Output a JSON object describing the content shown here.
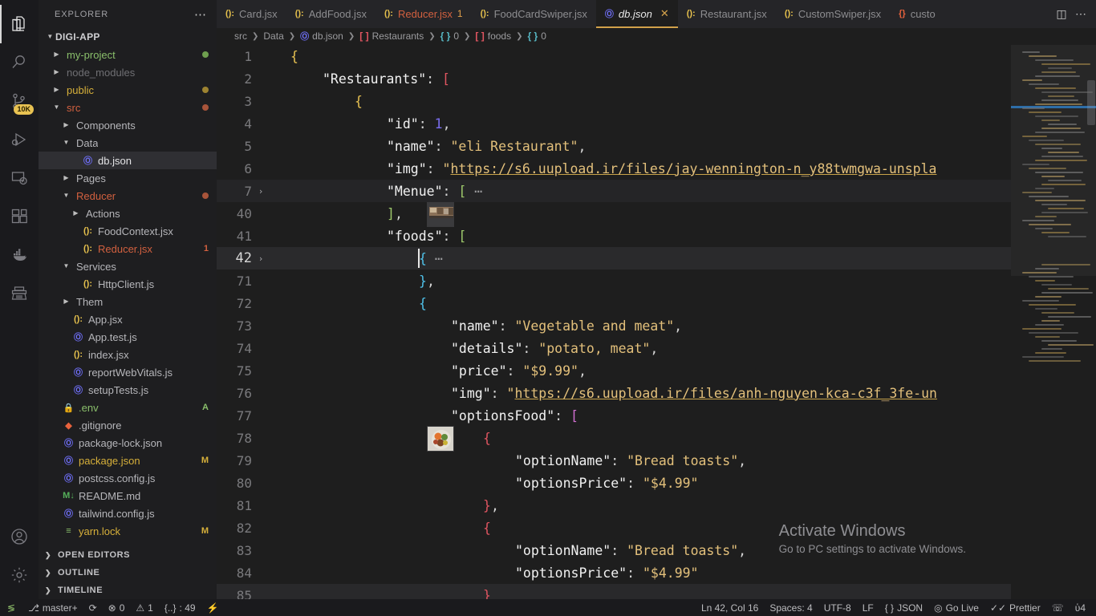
{
  "activity_bar": {
    "items": [
      {
        "name": "explorer",
        "icon": "files-icon",
        "active": true
      },
      {
        "name": "search",
        "icon": "search-icon",
        "active": false
      },
      {
        "name": "source-control",
        "icon": "source-control-icon",
        "active": false,
        "badge": "10K"
      },
      {
        "name": "run-and-debug",
        "icon": "run-debug-icon",
        "active": false
      },
      {
        "name": "remote-explorer",
        "icon": "remote-explorer-icon",
        "active": false
      },
      {
        "name": "extensions",
        "icon": "extensions-icon",
        "active": false
      },
      {
        "name": "docker",
        "icon": "docker-icon",
        "active": false
      },
      {
        "name": "test-explorer",
        "icon": "typewriter-icon",
        "active": false
      }
    ],
    "bottom_items": [
      {
        "name": "accounts",
        "icon": "account-icon"
      },
      {
        "name": "manage",
        "icon": "gear-icon"
      }
    ]
  },
  "sidebar": {
    "title": "EXPLORER",
    "more_actions": "⋯",
    "root": "DIGI-APP",
    "tree": [
      {
        "label": "my-project",
        "indent": 1,
        "arrow": "▶",
        "icon": "",
        "icon_class": "",
        "color": "#8abf6b",
        "status_dot": "#6f9f4f"
      },
      {
        "label": "node_modules",
        "indent": 1,
        "arrow": "▶",
        "icon": "",
        "icon_class": "",
        "color": "#6f6f73",
        "status_dot": ""
      },
      {
        "label": "public",
        "indent": 1,
        "arrow": "▶",
        "icon": "",
        "icon_class": "",
        "color": "#d7b03a",
        "status_dot": "#9d8331"
      },
      {
        "label": "src",
        "indent": 1,
        "arrow": "▼",
        "icon": "",
        "icon_class": "",
        "color": "#d2603f",
        "status_dot": "#a8543a"
      },
      {
        "label": "Components",
        "indent": 2,
        "arrow": "▶",
        "icon": "",
        "icon_class": "",
        "color": "#b6b6ba",
        "status_dot": ""
      },
      {
        "label": "Data",
        "indent": 2,
        "arrow": "▼",
        "icon": "",
        "icon_class": "",
        "color": "#b6b6ba",
        "status_dot": ""
      },
      {
        "label": "db.json",
        "indent": 3,
        "arrow": "",
        "icon": "Ⓞ",
        "icon_class": "i-json",
        "color": "#e4e4e6",
        "status_dot": "",
        "selected": true
      },
      {
        "label": "Pages",
        "indent": 2,
        "arrow": "▶",
        "icon": "",
        "icon_class": "",
        "color": "#b6b6ba",
        "status_dot": ""
      },
      {
        "label": "Reducer",
        "indent": 2,
        "arrow": "▼",
        "icon": "",
        "icon_class": "",
        "color": "#d2603f",
        "status_dot": "#a8543a"
      },
      {
        "label": "Actions",
        "indent": 3,
        "arrow": "▶",
        "icon": "",
        "icon_class": "",
        "color": "#b6b6ba",
        "status_dot": ""
      },
      {
        "label": "FoodContext.jsx",
        "indent": 3,
        "arrow": "",
        "icon": "():",
        "icon_class": "i-jsx",
        "color": "#b6b6ba",
        "status_dot": ""
      },
      {
        "label": "Reducer.jsx",
        "indent": 3,
        "arrow": "",
        "icon": "():",
        "icon_class": "i-jsx",
        "color": "#d2603f",
        "status_dot": "",
        "badge": "1",
        "badge_color": "#d2603f"
      },
      {
        "label": "Services",
        "indent": 2,
        "arrow": "▼",
        "icon": "",
        "icon_class": "",
        "color": "#b6b6ba",
        "status_dot": ""
      },
      {
        "label": "HttpClient.js",
        "indent": 3,
        "arrow": "",
        "icon": "():",
        "icon_class": "i-jsx",
        "color": "#b6b6ba",
        "status_dot": ""
      },
      {
        "label": "Them",
        "indent": 2,
        "arrow": "▶",
        "icon": "",
        "icon_class": "",
        "color": "#b6b6ba",
        "status_dot": ""
      },
      {
        "label": "App.jsx",
        "indent": 2,
        "arrow": "",
        "icon": "():",
        "icon_class": "i-jsx",
        "color": "#b6b6ba",
        "status_dot": ""
      },
      {
        "label": "App.test.js",
        "indent": 2,
        "arrow": "",
        "icon": "Ⓞ",
        "icon_class": "i-js",
        "color": "#b6b6ba",
        "status_dot": ""
      },
      {
        "label": "index.jsx",
        "indent": 2,
        "arrow": "",
        "icon": "():",
        "icon_class": "i-jsx",
        "color": "#b6b6ba",
        "status_dot": ""
      },
      {
        "label": "reportWebVitals.js",
        "indent": 2,
        "arrow": "",
        "icon": "Ⓞ",
        "icon_class": "i-js",
        "color": "#b6b6ba",
        "status_dot": ""
      },
      {
        "label": "setupTests.js",
        "indent": 2,
        "arrow": "",
        "icon": "Ⓞ",
        "icon_class": "i-js",
        "color": "#b6b6ba",
        "status_dot": ""
      },
      {
        "label": ".env",
        "indent": 1,
        "arrow": "",
        "icon": "🔒",
        "icon_class": "i-lock",
        "color": "#8abf6b",
        "status_dot": "",
        "badge": "A",
        "badge_color": "#8abf6b"
      },
      {
        "label": ".gitignore",
        "indent": 1,
        "arrow": "",
        "icon": "◆",
        "icon_class": "i-git",
        "color": "#b6b6ba",
        "status_dot": ""
      },
      {
        "label": "package-lock.json",
        "indent": 1,
        "arrow": "",
        "icon": "Ⓞ",
        "icon_class": "i-json",
        "color": "#b6b6ba",
        "status_dot": ""
      },
      {
        "label": "package.json",
        "indent": 1,
        "arrow": "",
        "icon": "Ⓞ",
        "icon_class": "i-json",
        "color": "#d7b03a",
        "status_dot": "",
        "badge": "M",
        "badge_color": "#d7b03a"
      },
      {
        "label": "postcss.config.js",
        "indent": 1,
        "arrow": "",
        "icon": "Ⓞ",
        "icon_class": "i-js",
        "color": "#b6b6ba",
        "status_dot": ""
      },
      {
        "label": "README.md",
        "indent": 1,
        "arrow": "",
        "icon": "M↓",
        "icon_class": "i-md",
        "color": "#b6b6ba",
        "status_dot": ""
      },
      {
        "label": "tailwind.config.js",
        "indent": 1,
        "arrow": "",
        "icon": "Ⓞ",
        "icon_class": "i-js",
        "color": "#b6b6ba",
        "status_dot": ""
      },
      {
        "label": "yarn.lock",
        "indent": 1,
        "arrow": "",
        "icon": "≡",
        "icon_class": "i-yarn",
        "color": "#d7b03a",
        "status_dot": "",
        "badge": "M",
        "badge_color": "#d7b03a"
      }
    ],
    "sections": [
      {
        "label": "OPEN EDITORS"
      },
      {
        "label": "OUTLINE"
      },
      {
        "label": "TIMELINE"
      }
    ]
  },
  "tabs": {
    "items": [
      {
        "label": "Card.jsx",
        "icon": "():",
        "icon_class": "i-jsx",
        "active": false,
        "badge": ""
      },
      {
        "label": "AddFood.jsx",
        "icon": "():",
        "icon_class": "i-jsx",
        "active": false,
        "badge": ""
      },
      {
        "label": "Reducer.jsx",
        "icon": "():",
        "icon_class": "i-jsx",
        "active": false,
        "badge": "1",
        "color": "#d2603f"
      },
      {
        "label": "FoodCardSwiper.jsx",
        "icon": "():",
        "icon_class": "i-jsx",
        "active": false,
        "badge": ""
      },
      {
        "label": "db.json",
        "icon": "Ⓞ",
        "icon_class": "i-json",
        "active": true,
        "badge": "",
        "close": "✕"
      },
      {
        "label": "Restaurant.jsx",
        "icon": "():",
        "icon_class": "i-jsx",
        "active": false,
        "badge": ""
      },
      {
        "label": "CustomSwiper.jsx",
        "icon": "():",
        "icon_class": "i-jsx",
        "active": false,
        "badge": ""
      },
      {
        "label": "custo",
        "icon": "{}",
        "icon_class": "i-git",
        "active": false,
        "badge": ""
      }
    ],
    "actions": [
      {
        "name": "split-editor-icon",
        "glyph": "◫"
      },
      {
        "name": "more-actions-icon",
        "glyph": "⋯"
      }
    ]
  },
  "breadcrumbs": [
    {
      "label": "src",
      "sym": "",
      "sym_class": ""
    },
    {
      "label": "Data",
      "sym": "",
      "sym_class": ""
    },
    {
      "label": "db.json",
      "sym": "Ⓞ",
      "sym_class": "sym-json"
    },
    {
      "label": "Restaurants",
      "sym": "[ ]",
      "sym_class": "sym-arr"
    },
    {
      "label": "0",
      "sym": "{ }",
      "sym_class": "sym-obj"
    },
    {
      "label": "foods",
      "sym": "[ ]",
      "sym_class": "sym-arr"
    },
    {
      "label": "0",
      "sym": "{ }",
      "sym_class": "sym-obj"
    }
  ],
  "editor": {
    "language": "JSON",
    "lines": [
      {
        "n": "1",
        "fold": "",
        "indent": 0,
        "html": "<span class='t-br-y'>{</span>"
      },
      {
        "n": "2",
        "fold": "",
        "indent": 1,
        "html": "<span class='t-key'>\"Restaurants\"</span><span class='t-punct'>: </span><span class='t-br-r'>[</span>"
      },
      {
        "n": "3",
        "fold": "",
        "indent": 2,
        "html": "<span class='t-br-y'>{</span>"
      },
      {
        "n": "4",
        "fold": "",
        "indent": 3,
        "html": "<span class='t-key'>\"id\"</span><span class='t-punct'>: </span><span class='t-num'>1</span><span class='t-punct'>,</span>"
      },
      {
        "n": "5",
        "fold": "",
        "indent": 3,
        "html": "<span class='t-key'>\"name\"</span><span class='t-punct'>: </span><span class='t-str'>\"eli Restaurant\"</span><span class='t-punct'>,</span>"
      },
      {
        "n": "6",
        "fold": "",
        "indent": 3,
        "img": true,
        "html": "<span class='t-key'>\"img\"</span><span class='t-punct'>: </span><span class='t-str'>\"</span><span class='t-url'>https://s6.uupload.ir/files/jay-wennington-n_y88twmgwa-unspla</span>"
      },
      {
        "n": "7",
        "fold": "›",
        "indent": 3,
        "dim": true,
        "html": "<span class='t-key'>\"Menue\"</span><span class='t-punct'>: </span><span class='t-br-g'>[</span><span class='t-dots'> ⋯</span>"
      },
      {
        "n": "40",
        "fold": "",
        "indent": 3,
        "html": "<span class='t-br-g'>]</span><span class='t-punct'>,</span>"
      },
      {
        "n": "41",
        "fold": "",
        "indent": 3,
        "html": "<span class='t-key'>\"foods\"</span><span class='t-punct'>: </span><span class='t-br-g'>[</span>"
      },
      {
        "n": "42",
        "fold": "›",
        "indent": 4,
        "cur": true,
        "html": "<span class='t-br-b t-cur'>{</span><span class='t-dots'> ⋯</span>"
      },
      {
        "n": "71",
        "fold": "",
        "indent": 4,
        "html": "<span class='t-br-b'>}</span><span class='t-punct'>,</span>"
      },
      {
        "n": "72",
        "fold": "",
        "indent": 4,
        "html": "<span class='t-br-b'>{</span>"
      },
      {
        "n": "73",
        "fold": "",
        "indent": 5,
        "html": "<span class='t-key'>\"name\"</span><span class='t-punct'>: </span><span class='t-str'>\"Vegetable and meat\"</span><span class='t-punct'>,</span>"
      },
      {
        "n": "74",
        "fold": "",
        "indent": 5,
        "html": "<span class='t-key'>\"details\"</span><span class='t-punct'>: </span><span class='t-str'>\"potato, meat\"</span><span class='t-punct'>,</span>"
      },
      {
        "n": "75",
        "fold": "",
        "indent": 5,
        "html": "<span class='t-key'>\"price\"</span><span class='t-punct'>: </span><span class='t-str'>\"$9.99\"</span><span class='t-punct'>,</span>"
      },
      {
        "n": "76",
        "fold": "",
        "indent": 5,
        "img2": true,
        "html": "<span class='t-key'>\"img\"</span><span class='t-punct'>: </span><span class='t-str'>\"</span><span class='t-url'>https://s6.uupload.ir/files/anh-nguyen-kca-c3f_3fe-un</span>"
      },
      {
        "n": "77",
        "fold": "",
        "indent": 5,
        "html": "<span class='t-key'>\"optionsFood\"</span><span class='t-punct'>: </span><span class='t-br-p'>[</span>"
      },
      {
        "n": "78",
        "fold": "",
        "indent": 6,
        "html": "<span class='t-br-r'>{</span>"
      },
      {
        "n": "79",
        "fold": "",
        "indent": 7,
        "html": "<span class='t-key'>\"optionName\"</span><span class='t-punct'>: </span><span class='t-str'>\"Bread toasts\"</span><span class='t-punct'>,</span>"
      },
      {
        "n": "80",
        "fold": "",
        "indent": 7,
        "html": "<span class='t-key'>\"optionsPrice\"</span><span class='t-punct'>: </span><span class='t-str'>\"$4.99\"</span>"
      },
      {
        "n": "81",
        "fold": "",
        "indent": 6,
        "html": "<span class='t-br-r'>}</span><span class='t-punct'>,</span>"
      },
      {
        "n": "82",
        "fold": "",
        "indent": 6,
        "html": "<span class='t-br-r'>{</span>"
      },
      {
        "n": "83",
        "fold": "",
        "indent": 7,
        "html": "<span class='t-key'>\"optionName\"</span><span class='t-punct'>: </span><span class='t-str'>\"Bread toasts\"</span><span class='t-punct'>,</span>"
      },
      {
        "n": "84",
        "fold": "",
        "indent": 7,
        "html": "<span class='t-key'>\"optionsPrice\"</span><span class='t-punct'>: </span><span class='t-str'>\"$4.99\"</span>"
      },
      {
        "n": "85",
        "fold": "",
        "indent": 6,
        "dim2": true,
        "html": "<span class='t-br-r'>}</span>"
      }
    ]
  },
  "watermark": {
    "title": "Activate Windows",
    "subtitle": "Go to PC settings to activate Windows."
  },
  "status_bar": {
    "left": [
      {
        "name": "remote-window",
        "glyph": "≶",
        "label": ""
      },
      {
        "name": "source-control-branch",
        "glyph": "⎇",
        "label": "master+"
      },
      {
        "name": "sync-changes",
        "glyph": "⟳",
        "label": ""
      },
      {
        "name": "problems-errors",
        "glyph": "⊗",
        "label": "0"
      },
      {
        "name": "problems-warnings",
        "glyph": "⚠",
        "label": "1"
      },
      {
        "name": "json-indent",
        "glyph": "{..}",
        "label": ": 49"
      },
      {
        "name": "lightning",
        "glyph": "⚡",
        "label": ""
      }
    ],
    "right": [
      {
        "name": "editor-position",
        "glyph": "",
        "label": "Ln 42, Col 16"
      },
      {
        "name": "indentation",
        "glyph": "",
        "label": "Spaces: 4"
      },
      {
        "name": "encoding",
        "glyph": "",
        "label": "UTF-8"
      },
      {
        "name": "eol",
        "glyph": "",
        "label": "LF"
      },
      {
        "name": "language-mode",
        "glyph": "{ }",
        "label": "JSON"
      },
      {
        "name": "go-live",
        "glyph": "◎",
        "label": "Go Live"
      },
      {
        "name": "prettier",
        "glyph": "✓✓",
        "label": "Prettier"
      },
      {
        "name": "feedback",
        "glyph": "☏",
        "label": ""
      },
      {
        "name": "notifications-bell",
        "glyph": "ὑ4",
        "label": ""
      }
    ]
  }
}
